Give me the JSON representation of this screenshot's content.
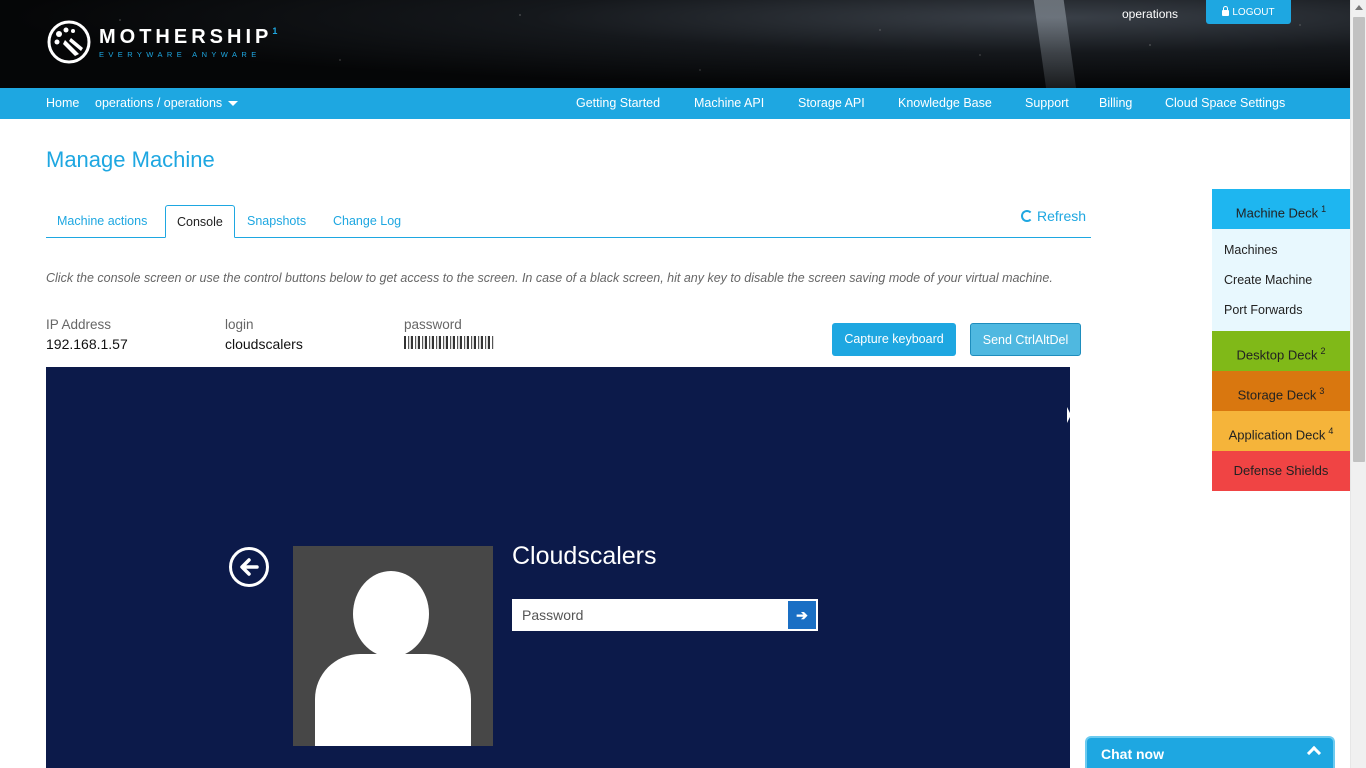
{
  "header": {
    "logo_name": "MOTHERSHIP",
    "logo_sup": "1",
    "logo_tagline": "EVERYWARE ANYWARE",
    "user": "operations",
    "logout_label": "LOGOUT"
  },
  "nav": {
    "home": "Home",
    "context": "operations / operations",
    "items": [
      "Getting Started",
      "Machine API",
      "Storage API",
      "Knowledge Base",
      "Support",
      "Billing",
      "Cloud Space Settings"
    ]
  },
  "main": {
    "title": "Manage Machine",
    "tabs": [
      "Machine actions",
      "Console",
      "Snapshots",
      "Change Log"
    ],
    "active_tab": "Console",
    "refresh_label": "Refresh",
    "instructions": "Click the console screen or use the control buttons below to get access to the screen. In case of a black screen, hit any key to disable the screen saving mode of your virtual machine.",
    "credentials": {
      "ip_label": "IP Address",
      "ip_value": "192.168.1.57",
      "login_label": "login",
      "login_value": "cloudscalers",
      "password_label": "password"
    },
    "buttons": {
      "capture": "Capture keyboard",
      "ctrlaltdel": "Send CtrlAltDel"
    },
    "console": {
      "user": "Cloudscalers",
      "password_placeholder": "Password"
    }
  },
  "deck": {
    "machine": {
      "label": "Machine Deck",
      "num": "1"
    },
    "machine_items": [
      "Machines",
      "Create Machine",
      "Port Forwards"
    ],
    "desktop": {
      "label": "Desktop Deck",
      "num": "2"
    },
    "storage": {
      "label": "Storage Deck",
      "num": "3"
    },
    "application": {
      "label": "Application Deck",
      "num": "4"
    },
    "defense": {
      "label": "Defense Shields"
    }
  },
  "chat": {
    "label": "Chat now"
  },
  "colors": {
    "accent": "#1ea7e1",
    "console_bg": "#0c1a4a",
    "desktop": "#80b918",
    "storage": "#d9770f",
    "application": "#f5b43a",
    "defense": "#f04444"
  }
}
